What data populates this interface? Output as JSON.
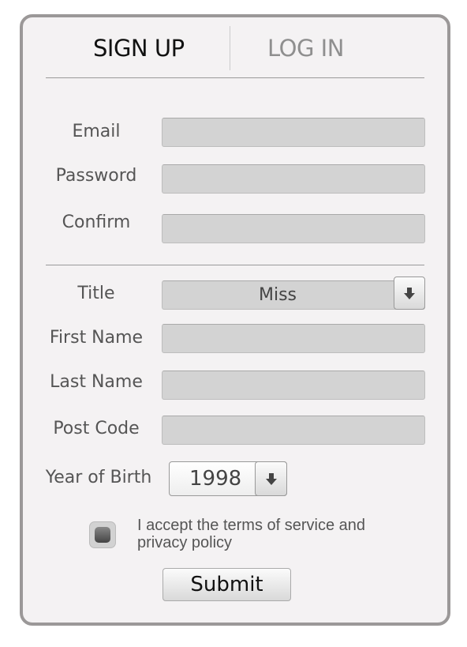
{
  "tabs": {
    "signup": "SIGN UP",
    "login": "LOG IN"
  },
  "fields": {
    "email": "Email",
    "password": "Password",
    "confirm": "Confirm",
    "title": "Title",
    "first_name": "First Name",
    "last_name": "Last Name",
    "post_code": "Post Code",
    "year_of_birth": "Year of Birth"
  },
  "values": {
    "title": "Miss",
    "year": "1998"
  },
  "terms": {
    "line1": "I accept the terms of service and",
    "line2": "privacy policy",
    "checked": false
  },
  "submit": "Submit",
  "icons": {
    "dropdown": "arrow-down-icon"
  }
}
